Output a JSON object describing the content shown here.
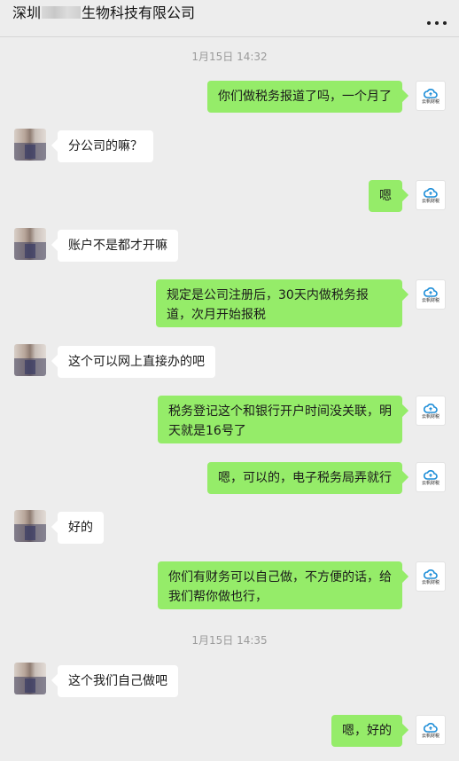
{
  "header": {
    "title_prefix": "深圳",
    "title_suffix": "生物科技有限公司",
    "more_icon": "more-dots-icon"
  },
  "timestamps": [
    "1月15日 14:32",
    "1月15日 14:35"
  ],
  "self_avatar": {
    "icon": "cloud-logo-icon",
    "caption": "云帆财税"
  },
  "messages": [
    {
      "from": "me",
      "text": "你们做税务报道了吗，一个月了"
    },
    {
      "from": "them",
      "text": "分公司的嘛？"
    },
    {
      "from": "me",
      "text": "嗯"
    },
    {
      "from": "them",
      "text": "账户不是都才开嘛"
    },
    {
      "from": "me",
      "text": "规定是公司注册后，30天内做税务报道，次月开始报税"
    },
    {
      "from": "them",
      "text": "这个可以网上直接办的吧"
    },
    {
      "from": "me",
      "text": "税务登记这个和银行开户时间没关联，明天就是16号了"
    },
    {
      "from": "me",
      "text": "嗯，可以的，电子税务局弄就行"
    },
    {
      "from": "them",
      "text": "好的"
    },
    {
      "from": "me",
      "text": "你们有财务可以自己做，不方便的话，给我们帮你做也行，"
    },
    {
      "from": "them",
      "text": "这个我们自己做吧"
    },
    {
      "from": "me",
      "text": "嗯，好的"
    }
  ],
  "colors": {
    "background": "#ededed",
    "outgoing_bubble": "#95ec69",
    "incoming_bubble": "#ffffff"
  }
}
